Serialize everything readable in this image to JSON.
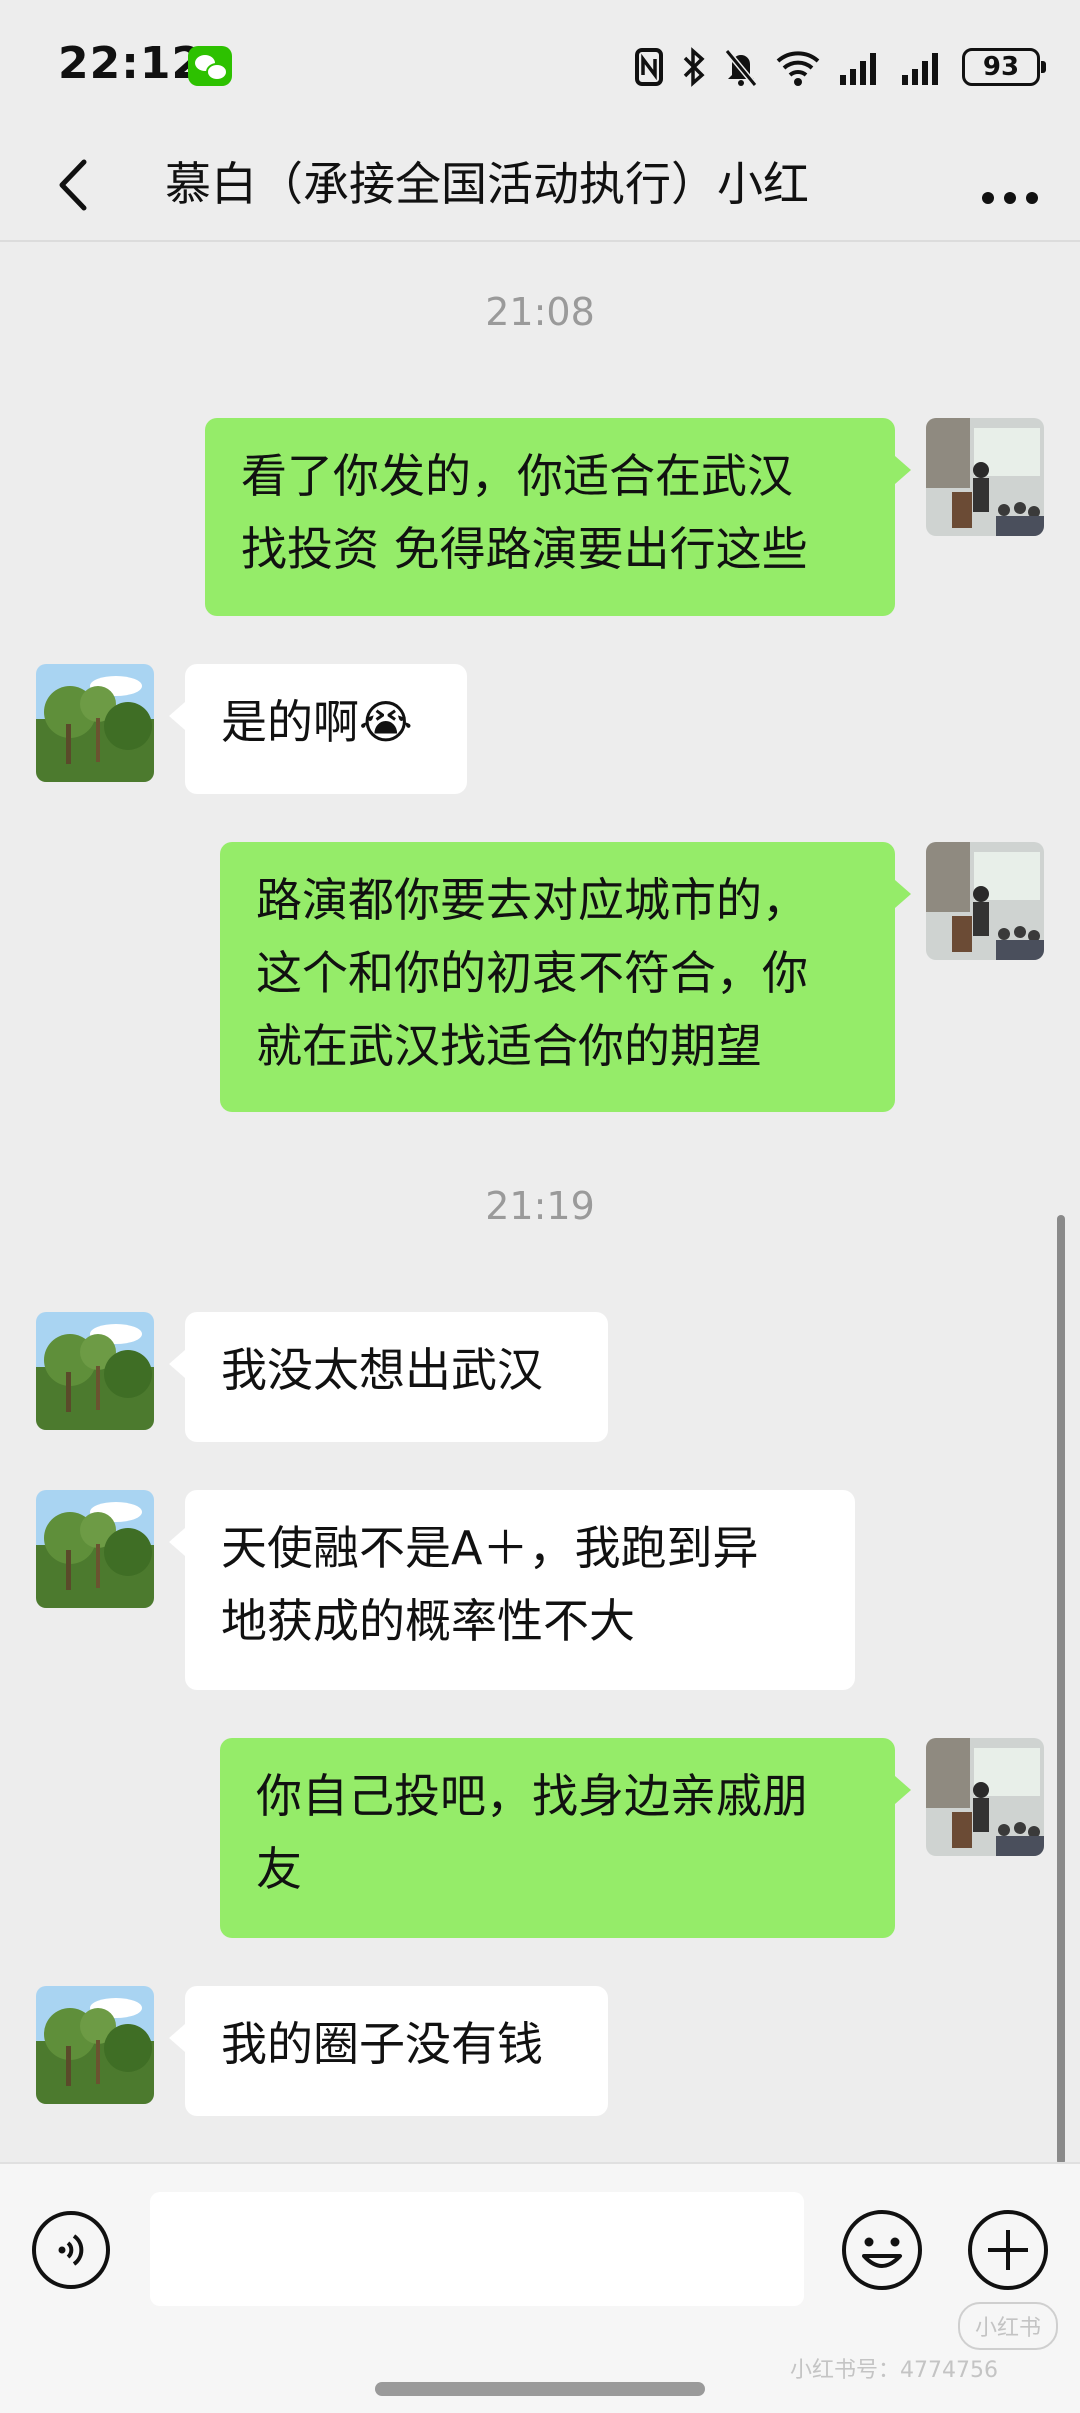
{
  "status_bar": {
    "time": "22:12",
    "battery": "93",
    "icons": [
      "wechat-app-icon",
      "nfc-icon",
      "bluetooth-icon",
      "mute-bell-icon",
      "wifi-icon",
      "signal-icon",
      "signal-icon",
      "battery-icon"
    ]
  },
  "nav": {
    "title": "慕白（承接全国活动执行）小红",
    "back_icon": "chevron-left-icon",
    "more_icon": "more-dots-icon"
  },
  "messages": {
    "ts1": "21:08",
    "m1_line1": "看了你发的，你适合在武汉",
    "m1_line2": "找投资 免得路演要出行这些",
    "m2": "是的啊",
    "m2_emoji": "😭",
    "m3_line1": "路演都你要去对应城市的，",
    "m3_line2": "这个和你的初衷不符合，你",
    "m3_line3": "就在武汉找适合你的期望",
    "ts2": "21:19",
    "m4": "我没太想出武汉",
    "m5_line1": "天使融不是A＋，我跑到异",
    "m5_line2": "地获成的概率性不大",
    "m6_line1": "你自己投吧，找身边亲戚朋",
    "m6_line2": "友",
    "m7": "我的圈子没有钱"
  },
  "input_bar": {
    "voice_icon": "voice-icon",
    "emoji_icon": "emoji-icon",
    "plus_icon": "plus-icon"
  },
  "watermark": {
    "logo": "小红书",
    "text": "小红书号：4774756"
  },
  "colors": {
    "background": "#ededed",
    "outgoing_bubble": "#95ec69",
    "incoming_bubble": "#ffffff",
    "timestamp": "#9a9a9a"
  }
}
